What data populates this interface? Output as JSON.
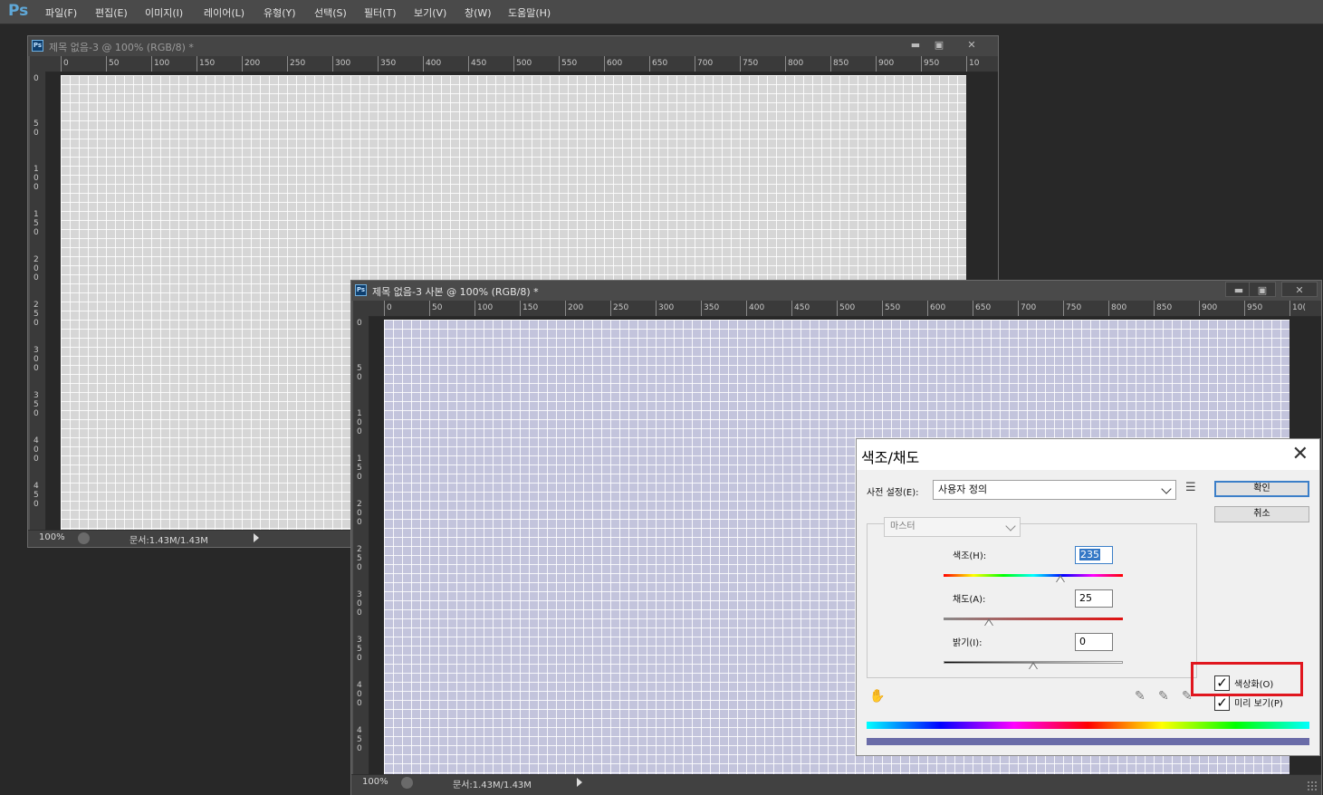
{
  "app": {
    "logo": "Ps",
    "menu": [
      "파일(F)",
      "편집(E)",
      "이미지(I)",
      "레이어(L)",
      "유형(Y)",
      "선택(S)",
      "필터(T)",
      "보기(V)",
      "창(W)",
      "도움말(H)"
    ]
  },
  "doc1": {
    "title": "제목 없음-3 @ 100% (RGB/8) *",
    "ruler_labels": [
      "0",
      "50",
      "100",
      "150",
      "200",
      "250",
      "300",
      "350",
      "400",
      "450",
      "500",
      "550",
      "600",
      "650",
      "700",
      "750",
      "800",
      "850",
      "900",
      "950",
      "10"
    ],
    "vruler_labels": [
      "0",
      "5\n0",
      "1\n0\n0",
      "1\n5\n0",
      "2\n0\n0",
      "2\n5\n0",
      "3\n0\n0",
      "3\n5\n0",
      "4\n0\n0",
      "4\n5\n0"
    ],
    "zoom": "100%",
    "doc_info": "문서:1.43M/1.43M",
    "buttons": {
      "minimize": "▬",
      "maximize": "▣",
      "close": "✕"
    }
  },
  "doc2": {
    "title": "제목 없음-3 사본 @ 100% (RGB/8) *",
    "ruler_labels": [
      "0",
      "50",
      "100",
      "150",
      "200",
      "250",
      "300",
      "350",
      "400",
      "450",
      "500",
      "550",
      "600",
      "650",
      "700",
      "750",
      "800",
      "850",
      "900",
      "950",
      "10("
    ],
    "vruler_labels": [
      "0",
      "5\n0",
      "1\n0\n0",
      "1\n5\n0",
      "2\n0\n0",
      "2\n5\n0",
      "3\n0\n0",
      "3\n5\n0",
      "4\n0\n0",
      "4\n5\n0"
    ],
    "zoom": "100%",
    "doc_info": "문서:1.43M/1.43M",
    "buttons": {
      "minimize": "▬",
      "maximize": "▣",
      "close": "✕"
    }
  },
  "dialog": {
    "title": "색조/채도",
    "close": "✕",
    "preset_label": "사전 설정(E):",
    "preset_value": "사용자 정의",
    "ok": "확인",
    "cancel": "취소",
    "channel": "마스터",
    "hue_label": "색조(H):",
    "hue_value": "235",
    "hue_fraction": 0.653,
    "saturation_label": "채도(A):",
    "saturation_value": "25",
    "saturation_fraction": 0.25,
    "lightness_label": "밝기(I):",
    "lightness_value": "0",
    "lightness_fraction": 0.5,
    "colorize_label": "색상화(O)",
    "colorize_checked": "✓",
    "preview_label": "미리 보기(P)",
    "preview_checked": "✓",
    "result_color": "#6a6ca8",
    "highlight_color": "#e0161e"
  }
}
